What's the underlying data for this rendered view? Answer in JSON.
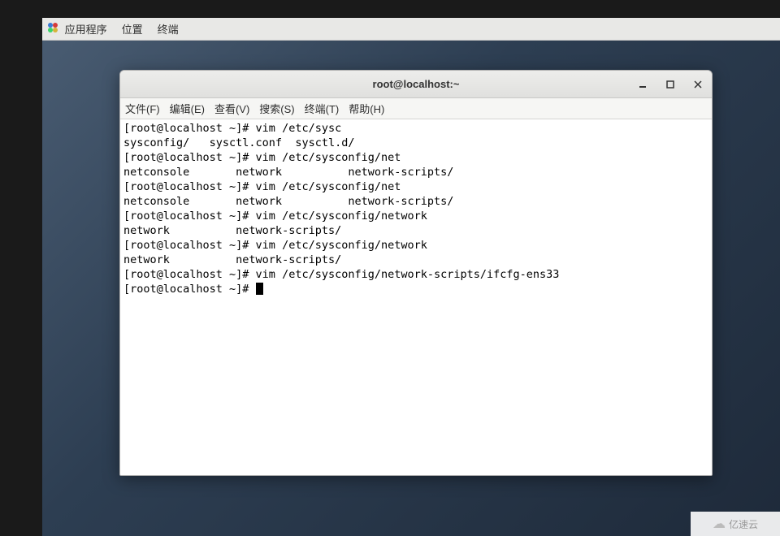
{
  "gnome_topbar": {
    "applications": "应用程序",
    "places": "位置",
    "terminal": "终端"
  },
  "window": {
    "title": "root@localhost:~",
    "controls": {
      "minimize": "minimize",
      "maximize": "maximize",
      "close": "close"
    }
  },
  "menubar": {
    "file": "文件(F)",
    "edit": "编辑(E)",
    "view": "查看(V)",
    "search": "搜索(S)",
    "terminal": "终端(T)",
    "help": "帮助(H)"
  },
  "terminal": {
    "lines": [
      "[root@localhost ~]# vim /etc/sysc",
      "sysconfig/   sysctl.conf  sysctl.d/",
      "[root@localhost ~]# vim /etc/sysconfig/net",
      "netconsole       network          network-scripts/",
      "[root@localhost ~]# vim /etc/sysconfig/net",
      "netconsole       network          network-scripts/",
      "[root@localhost ~]# vim /etc/sysconfig/network",
      "network          network-scripts/",
      "[root@localhost ~]# vim /etc/sysconfig/network",
      "network          network-scripts/",
      "[root@localhost ~]# vim /etc/sysconfig/network-scripts/ifcfg-ens33",
      "[root@localhost ~]# "
    ]
  },
  "watermark": {
    "text": "亿速云"
  }
}
